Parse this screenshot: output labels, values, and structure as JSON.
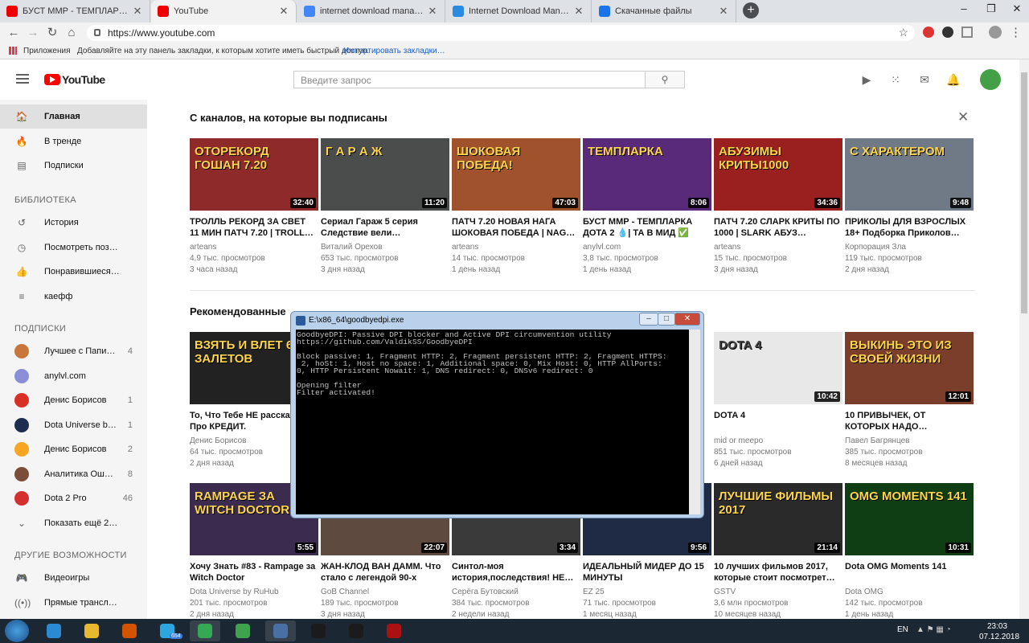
{
  "browser": {
    "tabs": [
      {
        "title": "БУСТ ММР - ТЕМПЛАРКА ДОТА 2",
        "color": "#e00"
      },
      {
        "title": "YouTube",
        "color": "#e00"
      },
      {
        "title": "internet download manager - По…",
        "color": "#4285f4"
      },
      {
        "title": "Internet Download Manager 6.30",
        "color": "#2b8be0"
      },
      {
        "title": "Скачанные файлы",
        "color": "#1a73e8"
      }
    ],
    "new_tab": "+",
    "url": "https://www.youtube.com",
    "bookmarks": {
      "apps": "Приложения",
      "hint": "Добавляйте на эту панель закладки, к которым хотите иметь быстрый доступ.",
      "import": "Импортировать закладки…"
    },
    "icons": {
      "back": "←",
      "forward": "→",
      "reload": "↻",
      "home": "⌂",
      "star": "☆",
      "menu": "⋮"
    }
  },
  "youtube": {
    "logo": "YouTube",
    "search_placeholder": "Введите запрос",
    "sidebar": {
      "main": [
        {
          "label": "Главная",
          "icon": "🏠"
        },
        {
          "label": "В тренде",
          "icon": "🔥"
        },
        {
          "label": "Подписки",
          "icon": "▤"
        }
      ],
      "library_head": "БИБЛИОТЕКА",
      "library": [
        {
          "label": "История",
          "icon": "↺"
        },
        {
          "label": "Посмотреть поз…",
          "icon": "◷"
        },
        {
          "label": "Понравившиеся…",
          "icon": "👍"
        },
        {
          "label": "каефф",
          "icon": "≡"
        }
      ],
      "subs_head": "ПОДПИСКИ",
      "subs": [
        {
          "label": "Лучшее с Папи…",
          "count": "4",
          "color": "#c9763b"
        },
        {
          "label": "anylvl.com",
          "count": "",
          "color": "#8a8fd8"
        },
        {
          "label": "Денис Борисов",
          "count": "1",
          "color": "#d93025"
        },
        {
          "label": "Dota Universe b…",
          "count": "1",
          "color": "#1d2d4f"
        },
        {
          "label": "Денис Борисов",
          "count": "2",
          "color": "#f5a623"
        },
        {
          "label": "Аналитика Ош…",
          "count": "8",
          "color": "#7b4e3a"
        },
        {
          "label": "Dota 2 Pro",
          "count": "46",
          "color": "#d32f2f"
        },
        {
          "label": "Показать ещё 2…",
          "count": "",
          "color": ""
        }
      ],
      "other_head": "ДРУГИЕ ВОЗМОЖНОСТИ",
      "other": [
        {
          "label": "Видеоигры",
          "icon": "🎮"
        },
        {
          "label": "Прямые трансл…",
          "icon": "((•))"
        }
      ]
    },
    "section1_title": "С каналов, на которые вы подписаны",
    "section2_title": "Рекомендованные",
    "row1": [
      {
        "title": "ТРОЛЛЬ РЕКОРД ЗА СВЕТ 11 МИН ПАТЧ 7.20 | TROLL…",
        "channel": "arteans",
        "views": "4,9 тыс. просмотров",
        "age": "3 часа назад",
        "duration": "32:40",
        "bg": "#8e2a2a",
        "overlay": "ОТОРЕКОРД ГОШАН 7.20"
      },
      {
        "title": "Сериал Гараж 5 серия Следствие вели…",
        "channel": "Виталий Орехов",
        "views": "653 тыс. просмотров",
        "age": "3 дня назад",
        "duration": "11:20",
        "bg": "#4b4d4d",
        "overlay": "Г А Р А Ж"
      },
      {
        "title": "ПАТЧ 7.20 НОВАЯ НАГА ШОКОВАЯ ПОБЕДА | NAG…",
        "channel": "arteans",
        "views": "14 тыс. просмотров",
        "age": "1 день назад",
        "duration": "47:03",
        "bg": "#a0522d",
        "overlay": "ШОКОВАЯ ПОБЕДА!"
      },
      {
        "title": "БУСТ ММР - ТЕМПЛАРКА ДОТА 2 💧| ТА В МИД ✅",
        "channel": "anylvl.com",
        "views": "3,8 тыс. просмотров",
        "age": "1 день назад",
        "duration": "8:06",
        "bg": "#5a2a7a",
        "overlay": "ТЕМПЛАРКА"
      },
      {
        "title": "ПАТЧ 7.20 СЛАРК КРИТЫ ПО 1000 | SLARK АБУЗ…",
        "channel": "arteans",
        "views": "15 тыс. просмотров",
        "age": "3 дня назад",
        "duration": "34:36",
        "bg": "#9a2020",
        "overlay": "АБУЗИМЫ КРИТЫ1000"
      },
      {
        "title": "ПРИКОЛЫ ДЛЯ ВЗРОСЛЫХ 18+ Подборка Приколов…",
        "channel": "Корпорация Зла",
        "views": "119 тыс. просмотров",
        "age": "2 дня назад",
        "duration": "9:48",
        "bg": "#6f7a86",
        "overlay": "С ХАРАКТЕРОМ"
      }
    ],
    "row2": [
      {
        "title": "То, Что Тебе НЕ расскажут Про КРЕДИТ.",
        "channel": "Денис Борисов",
        "views": "64 тыс. просмотров",
        "age": "2 дня назад",
        "duration": "",
        "bg": "#222",
        "overlay": "ВЗЯТЬ И ВЛЕТ 6 ЗАЛЕТОВ"
      },
      {
        "title": "DOTA 4",
        "channel": "mid or meepo",
        "views": "851 тыс. просмотров",
        "age": "6 дней назад",
        "duration": "10:42",
        "bg": "#e8e8e8",
        "overlay": "DOTA 4"
      },
      {
        "title": "10 ПРИВЫЧЕК, ОТ КОТОРЫХ НАДО…",
        "channel": "Павел Багрянцев",
        "views": "385 тыс. просмотров",
        "age": "8 месяцев назад",
        "duration": "12:01",
        "bg": "#7a3e2a",
        "overlay": "ВЫКИНЬ ЭТО ИЗ СВОЕЙ ЖИЗНИ"
      }
    ],
    "row3": [
      {
        "title": "Хочу Знать #83 - Rampage за Witch Doctor",
        "channel": "Dota Universe by RuHub",
        "views": "201 тыс. просмотров",
        "age": "2 дня назад",
        "duration": "5:55",
        "bg": "#3b2b4f",
        "overlay": "RAMPAGE ЗА WITCH DOCTOR"
      },
      {
        "title": "ЖАН-КЛОД ВАН ДАММ. Что стало с легендой 90-х",
        "channel": "GoB Channel",
        "views": "189 тыс. просмотров",
        "age": "3 дня назад",
        "duration": "22:07",
        "bg": "#5e4a3e",
        "overlay": ""
      },
      {
        "title": "Синтол-моя история,последствия! НЕ…",
        "channel": "Серёга Бутовский",
        "views": "384 тыс. просмотров",
        "age": "2 недели назад",
        "duration": "3:34",
        "bg": "#3a3a3a",
        "overlay": "Синтол"
      },
      {
        "title": "ИДЕАЛЬНЫЙ МИДЕР ДО 15 МИНУТЫ",
        "channel": "EZ 25",
        "views": "71 тыс. просмотров",
        "age": "1 месяц назад",
        "duration": "9:56",
        "bg": "#1f2a44",
        "overlay": "ДО 15 МИНУТЫ"
      },
      {
        "title": "10 лучших фильмов 2017, которые стоит посмотрет…",
        "channel": "GSTV",
        "views": "3,6 млн просмотров",
        "age": "10 месяцев назад",
        "duration": "21:14",
        "bg": "#2a2a2a",
        "overlay": "ЛУЧШИЕ ФИЛЬМЫ 2017"
      },
      {
        "title": "Dota OMG Moments 141",
        "channel": "Dota OMG",
        "views": "142 тыс. просмотров",
        "age": "1 день назад",
        "duration": "10:31",
        "bg": "#0f3d14",
        "overlay": "OMG MOMENTS 141"
      }
    ]
  },
  "console": {
    "title": "E:\\x86_64\\goodbyedpi.exe",
    "text": "GoodbyeDPI: Passive DPI blocker and Active DPI circumvention utility\nhttps://github.com/ValdikSS/GoodbyeDPI\n\nBlock passive: 1, Fragment HTTP: 2, Fragment persistent HTTP: 2, Fragment HTTPS:\n 2, hoSt: 1, Host no space: 1, Additional space: 0, Mix Host: 0, HTTP AllPorts:\n0, HTTP Persistent Nowait: 1, DNS redirect: 0, DNSv6 redirect: 0\n\nOpening filter\nFilter activated!"
  },
  "taskbar": {
    "lang": "EN",
    "time": "23:03",
    "date": "07.12.2018",
    "telegram_badge": "654"
  }
}
